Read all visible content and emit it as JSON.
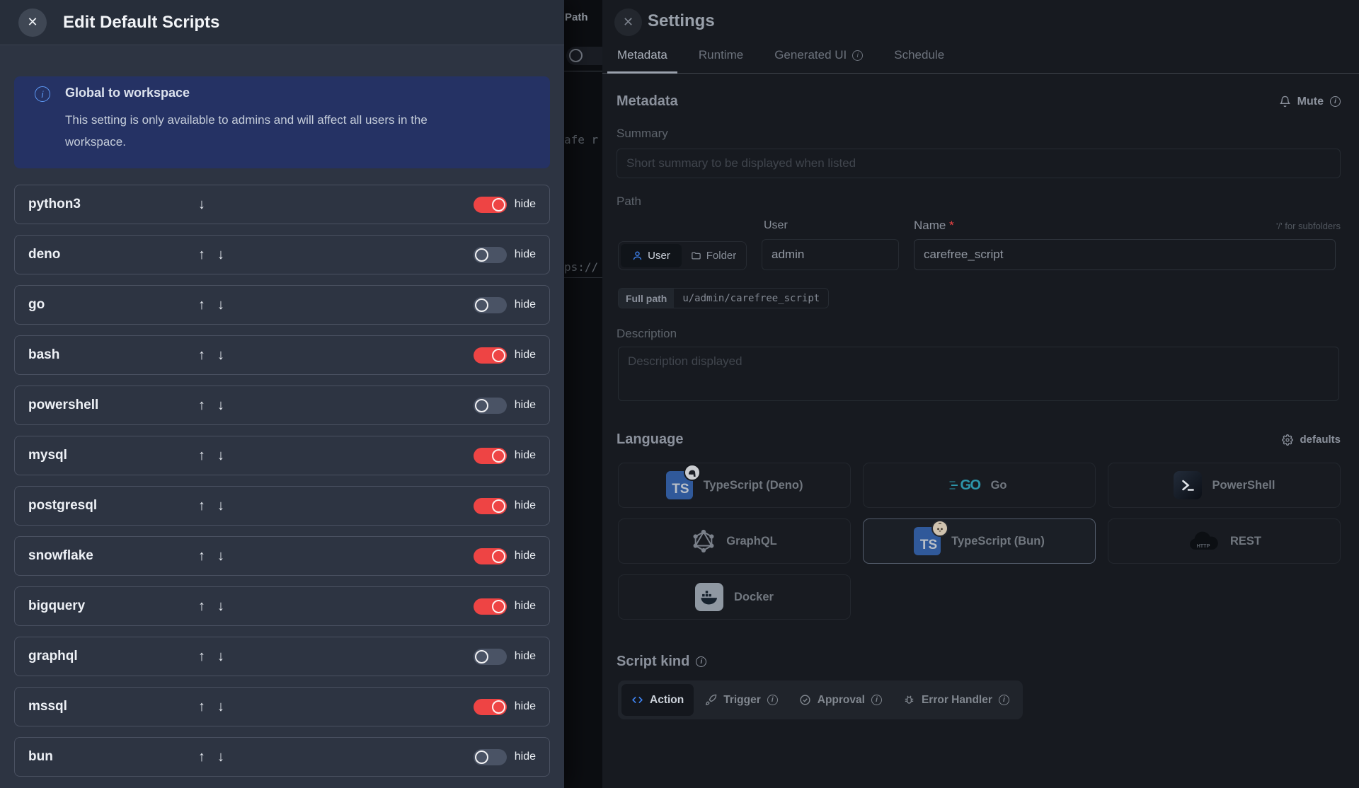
{
  "colors": {
    "accent_blue": "#3f83f0",
    "toggle_on_red": "#ee4444",
    "banner_bg": "#253264",
    "left_drawer_bg": "#2d3442",
    "right_drawer_bg": "#171a20"
  },
  "background_strip": {
    "path_label": "Path",
    "toggle_state": "off",
    "code_fragments": [
      "afe r",
      "ps://"
    ]
  },
  "left_panel": {
    "title": "Edit Default Scripts",
    "close_glyph": "✕",
    "banner": {
      "title": "Global to workspace",
      "body": "This setting is only available to admins and will affect all users in the workspace."
    },
    "hide_label": "hide",
    "rows": [
      {
        "name": "python3",
        "arrows": [
          "down"
        ],
        "hidden": true
      },
      {
        "name": "deno",
        "arrows": [
          "up",
          "down"
        ],
        "hidden": false
      },
      {
        "name": "go",
        "arrows": [
          "up",
          "down"
        ],
        "hidden": false
      },
      {
        "name": "bash",
        "arrows": [
          "up",
          "down"
        ],
        "hidden": true
      },
      {
        "name": "powershell",
        "arrows": [
          "up",
          "down"
        ],
        "hidden": false
      },
      {
        "name": "mysql",
        "arrows": [
          "up",
          "down"
        ],
        "hidden": true
      },
      {
        "name": "postgresql",
        "arrows": [
          "up",
          "down"
        ],
        "hidden": true
      },
      {
        "name": "snowflake",
        "arrows": [
          "up",
          "down"
        ],
        "hidden": true
      },
      {
        "name": "bigquery",
        "arrows": [
          "up",
          "down"
        ],
        "hidden": true
      },
      {
        "name": "graphql",
        "arrows": [
          "up",
          "down"
        ],
        "hidden": false
      },
      {
        "name": "mssql",
        "arrows": [
          "up",
          "down"
        ],
        "hidden": true
      },
      {
        "name": "bun",
        "arrows": [
          "up",
          "down"
        ],
        "hidden": false
      }
    ]
  },
  "settings_panel": {
    "title": "Settings",
    "close_glyph": "✕",
    "tabs": [
      {
        "label": "Metadata",
        "active": true,
        "info": false
      },
      {
        "label": "Runtime",
        "active": false,
        "info": false
      },
      {
        "label": "Generated UI",
        "active": false,
        "info": true
      },
      {
        "label": "Schedule",
        "active": false,
        "info": false
      }
    ],
    "metadata": {
      "heading": "Metadata",
      "mute_label": "Mute",
      "summary_label": "Summary",
      "summary_placeholder": "Short summary to be displayed when listed",
      "path_label": "Path",
      "owner_kind_options": [
        {
          "label": "User",
          "icon": "user",
          "active": true
        },
        {
          "label": "Folder",
          "icon": "folder",
          "active": false
        }
      ],
      "user_label": "User",
      "user_value": "admin",
      "name_label": "Name",
      "name_required_mark": "*",
      "subfolder_hint": "'/' for subfolders",
      "name_value": "carefree_script",
      "full_path_label": "Full path",
      "full_path_value": "u/admin/carefree_script",
      "description_label": "Description",
      "description_placeholder": "Description displayed"
    },
    "language": {
      "heading": "Language",
      "defaults_label": "defaults",
      "options": [
        {
          "label": "TypeScript (Deno)",
          "icon": "typescript-deno",
          "selected": false
        },
        {
          "label": "Go",
          "icon": "go",
          "selected": false
        },
        {
          "label": "PowerShell",
          "icon": "powershell",
          "selected": false
        },
        {
          "label": "GraphQL",
          "icon": "graphql",
          "selected": false
        },
        {
          "label": "TypeScript (Bun)",
          "icon": "typescript-bun",
          "selected": true
        },
        {
          "label": "REST",
          "icon": "rest-http",
          "selected": false
        },
        {
          "label": "Docker",
          "icon": "docker",
          "selected": false
        }
      ]
    },
    "script_kind": {
      "heading": "Script kind",
      "heading_info": true,
      "options": [
        {
          "label": "Action",
          "icon": "code",
          "active": true,
          "info": false
        },
        {
          "label": "Trigger",
          "icon": "rocket",
          "active": false,
          "info": true
        },
        {
          "label": "Approval",
          "icon": "check",
          "active": false,
          "info": true
        },
        {
          "label": "Error Handler",
          "icon": "bug",
          "active": false,
          "info": true
        }
      ]
    }
  }
}
